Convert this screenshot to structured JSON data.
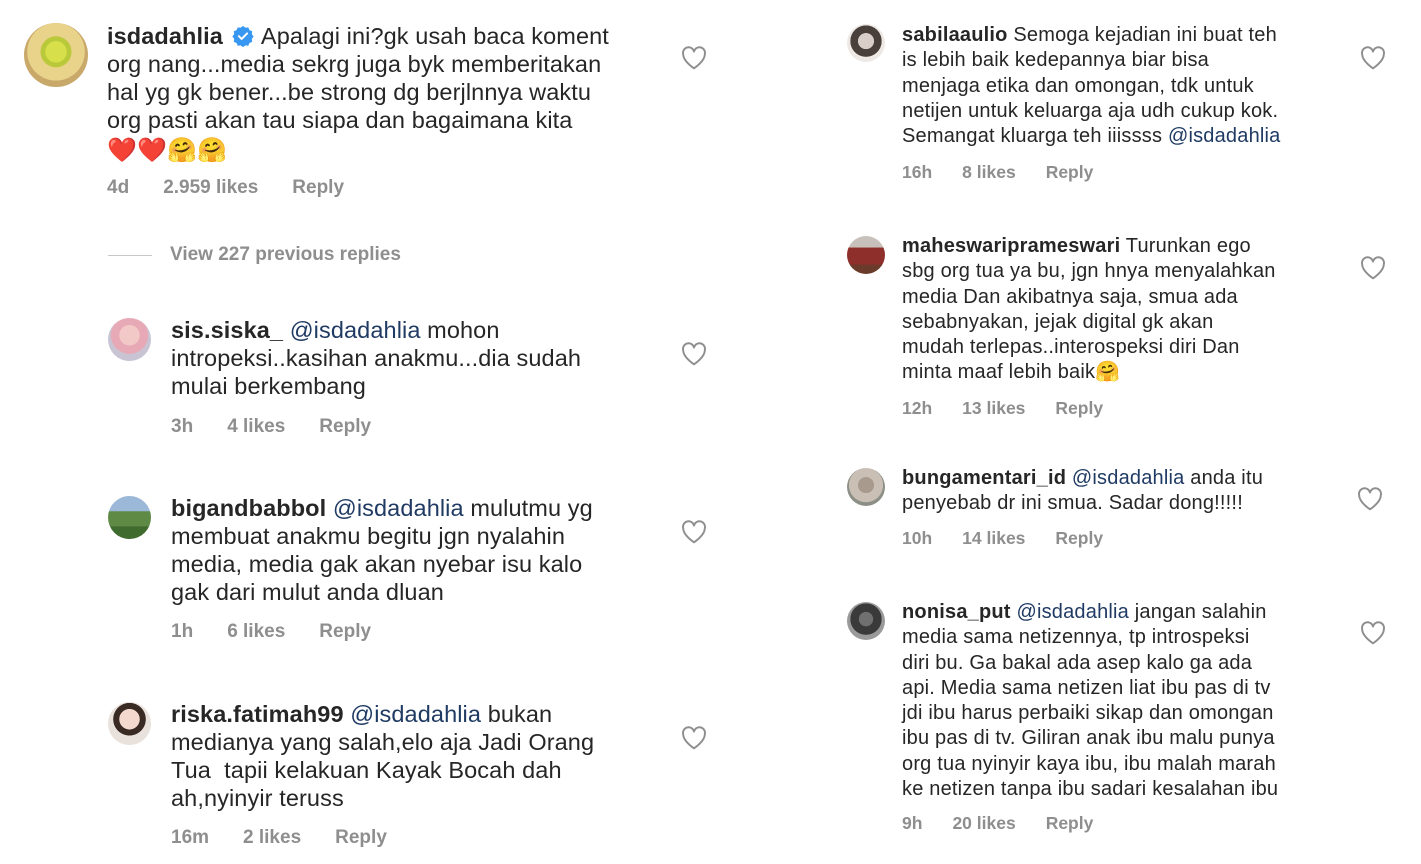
{
  "left": {
    "main": {
      "username": "isdadahlia",
      "verified_icon": "verified-badge-icon",
      "text_lines": [
        "Apalagi ini?gk usah baca koment",
        "org nang...media sekrg juga byk memberitakan",
        "hal yg gk bener...be strong dg berjlnnya waktu",
        "org pasti akan tau siapa dan bagaimana kita"
      ],
      "emoji_line": "❤️❤️🤗🤗",
      "time": "4d",
      "likes": "2.959 likes",
      "reply": "Reply"
    },
    "view_replies": "View 227 previous replies",
    "replies": [
      {
        "username": "sis.siska_",
        "mention": "@isdadahlia",
        "lines": [
          "mohon",
          "intropeksi..kasihan anakmu...dia sudah",
          "mulai berkembang"
        ],
        "time": "3h",
        "likes": "4 likes",
        "reply": "Reply"
      },
      {
        "username": "bigandbabbol",
        "mention": "@isdadahlia",
        "lines": [
          "mulutmu yg",
          "membuat anakmu begitu jgn nyalahin",
          "media, media gak akan nyebar isu kalo",
          "gak dari mulut anda dluan"
        ],
        "time": "1h",
        "likes": "6 likes",
        "reply": "Reply"
      },
      {
        "username": "riska.fatimah99",
        "mention": "@isdadahlia",
        "lines": [
          "bukan",
          "medianya yang salah,elo aja Jadi Orang",
          "Tua  tapii kelakuan Kayak Bocah dah",
          "ah,nyinyir teruss"
        ],
        "time": "16m",
        "likes": "2 likes",
        "reply": "Reply"
      }
    ]
  },
  "right": {
    "comments": [
      {
        "username": "sabilaaulio",
        "mention": "",
        "first": "Semoga kejadian ini buat teh",
        "lines": [
          "is lebih baik kedepannya biar bisa",
          "menjaga etika dan omongan, tdk untuk",
          "netijen untuk keluarga aja udh cukup kok."
        ],
        "last_pre": "Semangat kluarga teh iiissss ",
        "last_mention": "@isdadahlia",
        "time": "16h",
        "likes": "8 likes",
        "reply": "Reply"
      },
      {
        "username": "maheswariprameswari",
        "mention": "",
        "first": "Turunkan ego",
        "lines": [
          "sbg org tua ya bu, jgn hnya menyalahkan",
          "media Dan akibatnya saja, smua ada",
          "sebabnyakan, jejak digital gk akan",
          "mudah terlepas..interospeksi diri Dan"
        ],
        "last_pre": "minta maaf lebih baik🤗",
        "last_mention": "",
        "time": "12h",
        "likes": "13 likes",
        "reply": "Reply"
      },
      {
        "username": "bungamentari_id",
        "mention": "@isdadahlia",
        "first": "anda itu",
        "lines": [
          "penyebab dr ini smua. Sadar dong!!!!!"
        ],
        "last_pre": "",
        "last_mention": "",
        "time": "10h",
        "likes": "14 likes",
        "reply": "Reply"
      },
      {
        "username": "nonisa_put",
        "mention": "@isdadahlia",
        "first": "jangan salahin",
        "lines": [
          "media sama netizennya, tp introspeksi",
          "diri bu. Ga bakal ada asep kalo ga ada",
          "api. Media sama netizen liat ibu pas di tv",
          "jdi ibu harus perbaiki sikap dan omongan",
          "ibu pas di tv. Giliran anak ibu malu punya",
          "org tua nyinyir kaya ibu, ibu malah marah",
          "ke netizen tanpa ibu sadari kesalahan ibu"
        ],
        "last_pre": "",
        "last_mention": "",
        "time": "9h",
        "likes": "20 likes",
        "reply": "Reply"
      }
    ]
  },
  "icons": {
    "heart": "heart-outline-icon",
    "verified": "verified-badge-icon"
  },
  "colors": {
    "text": "#262626",
    "meta": "#8e8e8e",
    "mention": "#1f3a63",
    "verified": "#3897f0"
  }
}
